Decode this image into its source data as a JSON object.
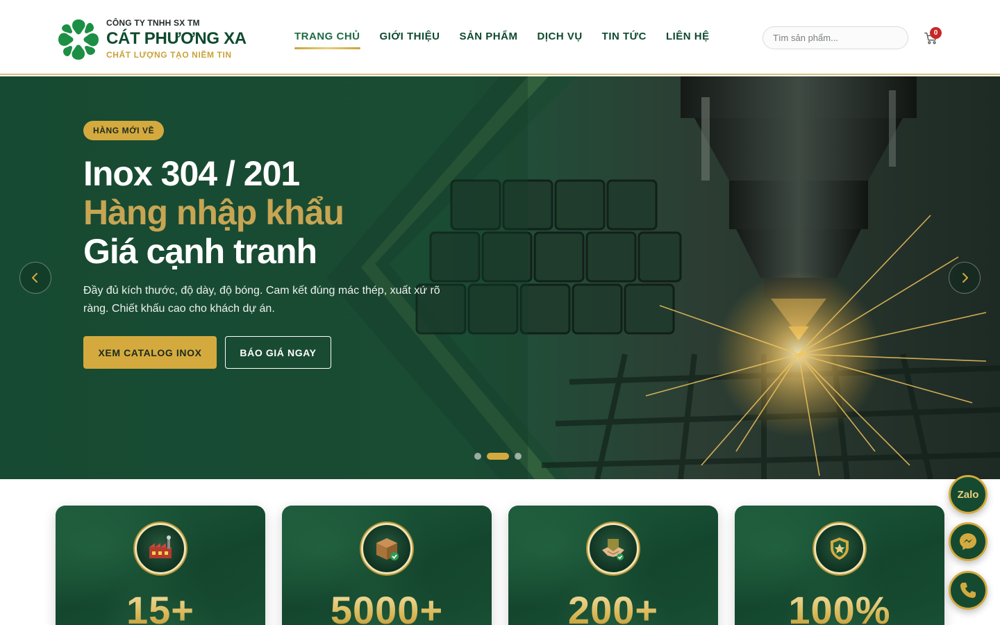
{
  "brand": {
    "company_prefix": "CÔNG TY TNHH SX TM",
    "name": "CÁT PHƯƠNG XA",
    "slogan": "CHẤT LƯỢNG TẠO NIỀM TIN"
  },
  "nav": {
    "items": [
      {
        "label": "TRANG CHỦ",
        "active": true
      },
      {
        "label": "GIỚI THIỆU"
      },
      {
        "label": "SẢN PHẨM"
      },
      {
        "label": "DỊCH VỤ"
      },
      {
        "label": "TIN TỨC"
      },
      {
        "label": "LIÊN HỆ"
      }
    ]
  },
  "search": {
    "placeholder": "Tìm sản phẩm..."
  },
  "cart": {
    "count": "0",
    "icon": "cart-icon"
  },
  "hero": {
    "badge": "HÀNG MỚI VỀ",
    "title_line1": "Inox 304 / 201",
    "title_line2": "Hàng nhập khẩu",
    "title_line3": "Giá cạnh tranh",
    "description": "Đầy đủ kích thước, độ dày, độ bóng. Cam kết đúng mác thép, xuất xứ rõ ràng. Chiết khấu cao cho khách dự án.",
    "primary_button": "XEM CATALOG INOX",
    "secondary_button": "BÁO GIÁ NGAY",
    "slides": 3,
    "active_slide": 2
  },
  "stats": [
    {
      "value": "15+",
      "icon": "factory-icon"
    },
    {
      "value": "5000+",
      "icon": "package-icon"
    },
    {
      "value": "200+",
      "icon": "handshake-icon"
    },
    {
      "value": "100%",
      "icon": "shield-star-icon"
    }
  ],
  "floating": {
    "zalo_label": "Zalo",
    "messenger_icon": "messenger-icon",
    "phone_icon": "phone-icon"
  },
  "colors": {
    "primary_green": "#0f4a2e",
    "gold": "#d4aa3f",
    "badge_red": "#c62828"
  }
}
